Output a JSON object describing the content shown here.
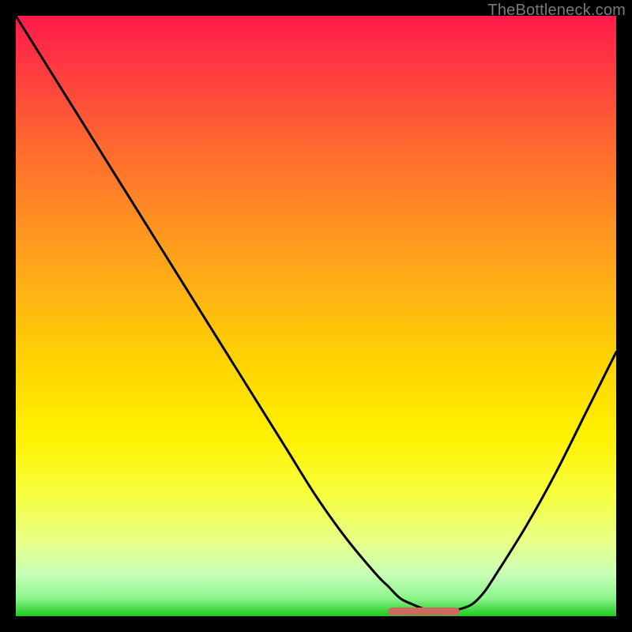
{
  "watermark": "TheBottleneck.com",
  "colors": {
    "background": "#000000",
    "curve": "#000000",
    "marker": "#cc6a60",
    "gradient_top": "#ff1a4b",
    "gradient_bottom": "#1ec91e"
  },
  "chart_data": {
    "type": "line",
    "title": "",
    "xlabel": "",
    "ylabel": "",
    "xlim": [
      0,
      100
    ],
    "ylim": [
      0,
      100
    ],
    "grid": false,
    "legend": false,
    "series": [
      {
        "name": "bottleneck-curve",
        "x": [
          0,
          5,
          10,
          15,
          20,
          25,
          30,
          35,
          40,
          45,
          50,
          55,
          60,
          62,
          64,
          66,
          68,
          70,
          72,
          74,
          76,
          78,
          80,
          85,
          90,
          95,
          100
        ],
        "values": [
          100,
          92,
          84,
          76,
          68,
          60,
          52,
          44,
          36,
          28,
          20,
          13,
          7,
          5,
          3,
          2,
          1.2,
          0.8,
          0.8,
          1.2,
          2,
          4,
          7,
          15,
          24,
          34,
          44
        ]
      }
    ],
    "annotations": [
      {
        "name": "minimum-marker",
        "x_start": 62,
        "x_end": 74,
        "y": 0.8
      }
    ]
  }
}
